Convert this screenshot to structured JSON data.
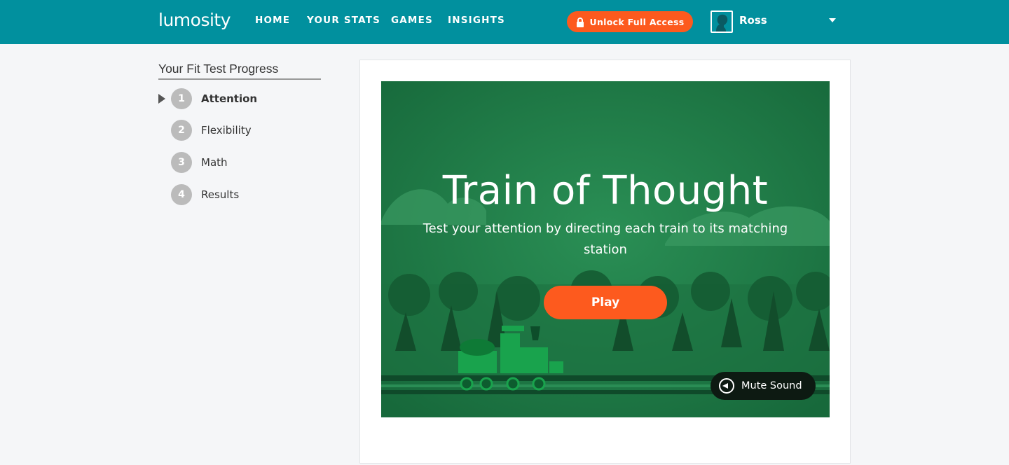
{
  "header": {
    "logo": "lumosity",
    "nav": [
      "HOME",
      "YOUR STATS",
      "GAMES",
      "INSIGHTS"
    ],
    "unlock_label": "Unlock Full Access",
    "user_name": "Ross"
  },
  "sidebar": {
    "title": "Your Fit Test Progress",
    "steps": [
      {
        "num": "1",
        "label": "Attention"
      },
      {
        "num": "2",
        "label": "Flexibility"
      },
      {
        "num": "3",
        "label": "Math"
      },
      {
        "num": "4",
        "label": "Results"
      }
    ]
  },
  "game": {
    "title": "Train of Thought",
    "description": "Test your attention by directing each train to its matching station",
    "play_label": "Play",
    "mute_label": "Mute Sound"
  },
  "colors": {
    "brand_teal": "#01909e",
    "accent_orange": "#fd5a1e",
    "game_green": "#1e7d47"
  }
}
